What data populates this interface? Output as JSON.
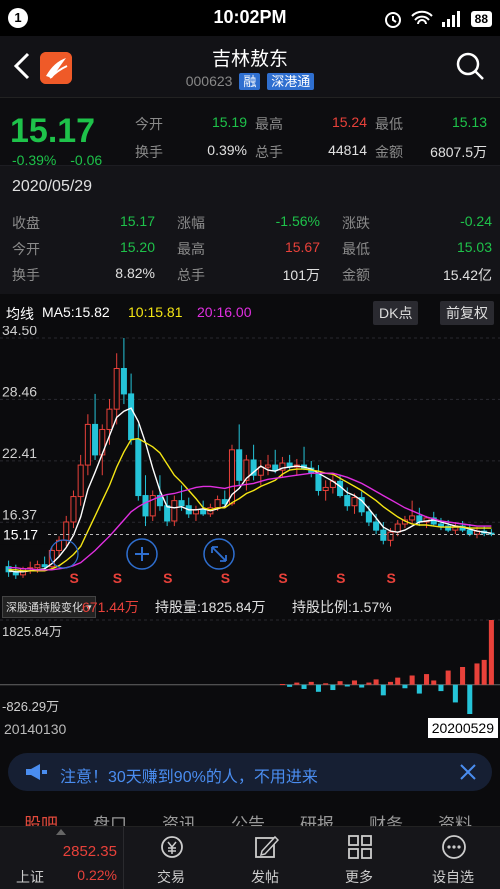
{
  "status_bar": {
    "notification_count": "1",
    "time": "10:02PM",
    "battery": "88"
  },
  "header": {
    "title": "吉林敖东",
    "code": "000623",
    "tags": [
      "融",
      "深港通"
    ]
  },
  "quote": {
    "price": "15.17",
    "change_pct": "-0.39%",
    "change_val": "-0.06",
    "rows": [
      [
        {
          "label": "今开",
          "value": "15.19",
          "color": "#1ec24a"
        },
        {
          "label": "最高",
          "value": "15.24",
          "color": "#e8413a"
        },
        {
          "label": "最低",
          "value": "15.13",
          "color": "#1ec24a"
        }
      ],
      [
        {
          "label": "换手",
          "value": "0.39%",
          "color": "#e0e0e0"
        },
        {
          "label": "总手",
          "value": "44814",
          "color": "#e0e0e0"
        },
        {
          "label": "金额",
          "value": "6807.5万",
          "color": "#e0e0e0"
        }
      ]
    ]
  },
  "day_detail": {
    "date": "2020/05/29",
    "rows": [
      [
        {
          "label": "收盘",
          "value": "15.17",
          "color": "#1ec24a"
        },
        {
          "label": "涨幅",
          "value": "-1.56%",
          "color": "#1ec24a"
        },
        {
          "label": "涨跌",
          "value": "-0.24",
          "color": "#1ec24a"
        }
      ],
      [
        {
          "label": "今开",
          "value": "15.20",
          "color": "#1ec24a"
        },
        {
          "label": "最高",
          "value": "15.67",
          "color": "#e8413a"
        },
        {
          "label": "最低",
          "value": "15.03",
          "color": "#1ec24a"
        }
      ],
      [
        {
          "label": "换手",
          "value": "8.82%",
          "color": "#e0e0e0"
        },
        {
          "label": "总手",
          "value": "101万",
          "color": "#e0e0e0"
        },
        {
          "label": "金额",
          "value": "15.42亿",
          "color": "#e0e0e0"
        }
      ]
    ]
  },
  "ma_bar": {
    "label": "均线",
    "ma5": "MA5:15.82",
    "ma10": "10:15.81",
    "ma20": "20:16.00",
    "dk_button": "DK点",
    "adjust_button": "前复权"
  },
  "kline": {
    "y_ticks": [
      "34.50",
      "28.46",
      "22.41",
      "16.37"
    ],
    "current_price_label": "15.17",
    "sell_marker": "S",
    "ylim": [
      10.3,
      34.5
    ],
    "candles": [
      {
        "o": 12.0,
        "h": 12.6,
        "l": 11.0,
        "c": 11.5
      },
      {
        "o": 11.5,
        "h": 12.2,
        "l": 10.8,
        "c": 11.2
      },
      {
        "o": 11.2,
        "h": 12.0,
        "l": 10.9,
        "c": 11.8
      },
      {
        "o": 11.8,
        "h": 12.5,
        "l": 11.3,
        "c": 11.9
      },
      {
        "o": 11.9,
        "h": 12.6,
        "l": 11.4,
        "c": 12.2
      },
      {
        "o": 12.2,
        "h": 13.0,
        "l": 11.8,
        "c": 12.0
      },
      {
        "o": 12.0,
        "h": 14.0,
        "l": 11.8,
        "c": 13.6
      },
      {
        "o": 13.6,
        "h": 15.0,
        "l": 13.0,
        "c": 14.6
      },
      {
        "o": 14.6,
        "h": 17.0,
        "l": 14.0,
        "c": 16.4
      },
      {
        "o": 16.4,
        "h": 19.5,
        "l": 15.8,
        "c": 18.9
      },
      {
        "o": 18.9,
        "h": 23.0,
        "l": 18.0,
        "c": 22.0
      },
      {
        "o": 22.0,
        "h": 27.0,
        "l": 21.0,
        "c": 26.0
      },
      {
        "o": 26.0,
        "h": 29.0,
        "l": 22.5,
        "c": 23.0
      },
      {
        "o": 23.0,
        "h": 26.0,
        "l": 21.0,
        "c": 25.5
      },
      {
        "o": 25.5,
        "h": 28.5,
        "l": 24.0,
        "c": 27.5
      },
      {
        "o": 27.5,
        "h": 33.0,
        "l": 26.0,
        "c": 31.5
      },
      {
        "o": 31.5,
        "h": 34.5,
        "l": 28.0,
        "c": 29.0
      },
      {
        "o": 29.0,
        "h": 31.0,
        "l": 24.0,
        "c": 24.5
      },
      {
        "o": 24.5,
        "h": 26.0,
        "l": 18.5,
        "c": 19.0
      },
      {
        "o": 19.0,
        "h": 21.0,
        "l": 16.0,
        "c": 17.0
      },
      {
        "o": 17.0,
        "h": 19.5,
        "l": 16.5,
        "c": 19.0
      },
      {
        "o": 19.0,
        "h": 21.0,
        "l": 17.5,
        "c": 18.0
      },
      {
        "o": 18.0,
        "h": 19.0,
        "l": 16.0,
        "c": 16.5
      },
      {
        "o": 16.5,
        "h": 19.0,
        "l": 16.0,
        "c": 18.5
      },
      {
        "o": 18.5,
        "h": 20.0,
        "l": 17.5,
        "c": 18.0
      },
      {
        "o": 18.0,
        "h": 18.8,
        "l": 16.8,
        "c": 17.2
      },
      {
        "o": 17.2,
        "h": 18.0,
        "l": 16.5,
        "c": 17.6
      },
      {
        "o": 17.6,
        "h": 18.5,
        "l": 17.0,
        "c": 17.2
      },
      {
        "o": 17.2,
        "h": 18.2,
        "l": 16.9,
        "c": 17.8
      },
      {
        "o": 17.8,
        "h": 19.0,
        "l": 17.5,
        "c": 18.6
      },
      {
        "o": 18.6,
        "h": 19.5,
        "l": 18.0,
        "c": 18.2
      },
      {
        "o": 18.2,
        "h": 24.0,
        "l": 18.0,
        "c": 23.5
      },
      {
        "o": 23.5,
        "h": 26.0,
        "l": 20.0,
        "c": 20.5
      },
      {
        "o": 20.5,
        "h": 23.0,
        "l": 19.5,
        "c": 22.5
      },
      {
        "o": 22.5,
        "h": 24.0,
        "l": 20.5,
        "c": 21.0
      },
      {
        "o": 21.0,
        "h": 22.5,
        "l": 20.0,
        "c": 21.8
      },
      {
        "o": 21.8,
        "h": 23.0,
        "l": 21.0,
        "c": 22.0
      },
      {
        "o": 22.0,
        "h": 23.5,
        "l": 21.2,
        "c": 21.5
      },
      {
        "o": 21.5,
        "h": 22.8,
        "l": 20.8,
        "c": 22.2
      },
      {
        "o": 22.2,
        "h": 23.0,
        "l": 21.5,
        "c": 21.8
      },
      {
        "o": 21.8,
        "h": 22.6,
        "l": 21.0,
        "c": 22.0
      },
      {
        "o": 22.0,
        "h": 23.8,
        "l": 21.5,
        "c": 21.7
      },
      {
        "o": 21.7,
        "h": 22.4,
        "l": 20.8,
        "c": 21.2
      },
      {
        "o": 21.2,
        "h": 22.0,
        "l": 19.0,
        "c": 19.5
      },
      {
        "o": 19.5,
        "h": 20.5,
        "l": 18.5,
        "c": 19.8
      },
      {
        "o": 19.8,
        "h": 21.0,
        "l": 19.2,
        "c": 20.4
      },
      {
        "o": 20.4,
        "h": 21.0,
        "l": 18.8,
        "c": 19.0
      },
      {
        "o": 19.0,
        "h": 19.8,
        "l": 17.5,
        "c": 18.0
      },
      {
        "o": 18.0,
        "h": 19.2,
        "l": 17.2,
        "c": 18.8
      },
      {
        "o": 18.8,
        "h": 19.4,
        "l": 17.0,
        "c": 17.4
      },
      {
        "o": 17.4,
        "h": 18.0,
        "l": 16.0,
        "c": 16.4
      },
      {
        "o": 16.4,
        "h": 17.2,
        "l": 15.2,
        "c": 15.6
      },
      {
        "o": 15.6,
        "h": 16.4,
        "l": 14.2,
        "c": 14.6
      },
      {
        "o": 14.6,
        "h": 15.8,
        "l": 14.0,
        "c": 15.4
      },
      {
        "o": 15.4,
        "h": 16.6,
        "l": 15.0,
        "c": 16.2
      },
      {
        "o": 16.2,
        "h": 17.0,
        "l": 15.8,
        "c": 16.6
      },
      {
        "o": 16.6,
        "h": 18.5,
        "l": 16.2,
        "c": 17.0
      },
      {
        "o": 17.0,
        "h": 17.8,
        "l": 16.0,
        "c": 16.4
      },
      {
        "o": 16.4,
        "h": 17.0,
        "l": 15.8,
        "c": 16.8
      },
      {
        "o": 16.8,
        "h": 17.4,
        "l": 16.0,
        "c": 16.2
      },
      {
        "o": 16.2,
        "h": 16.8,
        "l": 15.6,
        "c": 16.0
      },
      {
        "o": 16.0,
        "h": 16.6,
        "l": 15.4,
        "c": 15.6
      },
      {
        "o": 15.6,
        "h": 16.4,
        "l": 15.2,
        "c": 16.0
      },
      {
        "o": 16.0,
        "h": 16.5,
        "l": 15.4,
        "c": 15.6
      },
      {
        "o": 15.6,
        "h": 16.2,
        "l": 15.0,
        "c": 15.2
      },
      {
        "o": 15.2,
        "h": 15.9,
        "l": 14.8,
        "c": 15.5
      },
      {
        "o": 15.5,
        "h": 16.0,
        "l": 15.0,
        "c": 15.3
      },
      {
        "o": 15.3,
        "h": 15.7,
        "l": 15.0,
        "c": 15.2
      }
    ],
    "ma5": [
      11.6,
      11.5,
      11.5,
      11.6,
      11.7,
      11.8,
      12.3,
      13.0,
      13.9,
      15.1,
      16.9,
      19.6,
      21.3,
      23.1,
      24.9,
      26.7,
      27.3,
      27.6,
      26.3,
      24.2,
      21.7,
      19.5,
      17.9,
      17.8,
      17.9,
      17.6,
      17.6,
      17.7,
      17.5,
      17.7,
      17.9,
      19.1,
      19.7,
      20.7,
      21.3,
      21.9,
      21.5,
      21.4,
      21.7,
      21.8,
      21.9,
      21.8,
      21.6,
      21.2,
      20.8,
      20.4,
      19.9,
      19.3,
      19.0,
      18.5,
      17.7,
      16.8,
      15.9,
      15.5,
      15.4,
      15.6,
      16.0,
      16.4,
      16.5,
      16.6,
      16.4,
      16.2,
      16.0,
      15.9,
      15.7,
      15.5,
      15.4,
      15.3
    ],
    "ma10": [
      11.7,
      11.7,
      11.6,
      11.6,
      11.6,
      11.6,
      11.8,
      12.1,
      12.6,
      13.2,
      14.0,
      15.5,
      17.0,
      18.5,
      20.0,
      21.8,
      23.3,
      24.5,
      24.6,
      24.2,
      23.8,
      23.2,
      22.1,
      21.0,
      20.3,
      19.5,
      18.7,
      17.8,
      17.6,
      17.8,
      17.8,
      18.3,
      18.7,
      19.2,
      19.5,
      19.9,
      20.2,
      20.5,
      21.1,
      21.5,
      21.6,
      21.6,
      21.5,
      21.4,
      21.2,
      21.1,
      20.7,
      20.3,
      19.9,
      19.5,
      19.0,
      18.5,
      17.9,
      17.4,
      16.9,
      16.5,
      16.2,
      16.1,
      16.1,
      16.0,
      15.9,
      15.9,
      15.9,
      15.9,
      15.8,
      15.8,
      15.8,
      15.8
    ],
    "ma20": [
      11.9,
      11.9,
      11.8,
      11.8,
      11.7,
      11.7,
      11.7,
      11.8,
      11.9,
      12.1,
      12.4,
      13.0,
      13.6,
      14.3,
      15.0,
      15.8,
      16.6,
      17.4,
      17.9,
      18.3,
      18.6,
      18.9,
      19.1,
      19.2,
      19.4,
      19.6,
      19.8,
      19.9,
      19.9,
      19.8,
      19.7,
      19.9,
      20.0,
      20.1,
      20.2,
      20.4,
      20.6,
      20.7,
      20.8,
      20.9,
      21.0,
      21.1,
      21.2,
      21.2,
      21.2,
      21.2,
      21.0,
      20.8,
      20.5,
      20.2,
      19.8,
      19.4,
      19.0,
      18.6,
      18.2,
      17.8,
      17.5,
      17.2,
      16.9,
      16.7,
      16.5,
      16.4,
      16.3,
      16.2,
      16.1,
      16.0,
      16.0,
      16.0
    ]
  },
  "volume": {
    "selector": "深股通持股变化",
    "change": "671.44万",
    "holdings": "持股量:1825.84万",
    "ratio": "持股比例:1.57%",
    "y_max_label": "1825.84万",
    "y_min_label": "-826.29万",
    "ylim": [
      -826.29,
      1825.84
    ],
    "values": [
      0,
      0,
      0,
      0,
      0,
      0,
      0,
      0,
      0,
      0,
      0,
      0,
      0,
      0,
      0,
      0,
      0,
      0,
      0,
      0,
      0,
      0,
      0,
      0,
      0,
      0,
      0,
      0,
      0,
      0,
      0,
      0,
      0,
      0,
      0,
      0,
      0,
      0,
      20,
      -60,
      60,
      -120,
      80,
      -200,
      40,
      -150,
      100,
      -50,
      120,
      -80,
      60,
      150,
      -300,
      80,
      200,
      -100,
      260,
      -250,
      300,
      120,
      -180,
      400,
      -500,
      500,
      -826.29,
      600,
      700,
      1825.84
    ]
  },
  "dates": {
    "start": "20140130",
    "end": "20200529"
  },
  "banner": {
    "text": "注意！30天赚到90%的人，不用进来"
  },
  "tabs": [
    "股吧",
    "盘口",
    "资讯",
    "公告",
    "研报",
    "财务",
    "资料"
  ],
  "bottom_bar": {
    "index_value": "2852.35",
    "index_name": "上证",
    "index_change": "0.22%",
    "items": [
      "交易",
      "发帖",
      "更多",
      "设自选"
    ]
  },
  "colors": {
    "up": "#e8413a",
    "down": "#1ec24a",
    "ma5": "#ffffff",
    "ma10": "#f5e614",
    "ma20": "#e02fe0",
    "accent": "#2f6fd0"
  }
}
